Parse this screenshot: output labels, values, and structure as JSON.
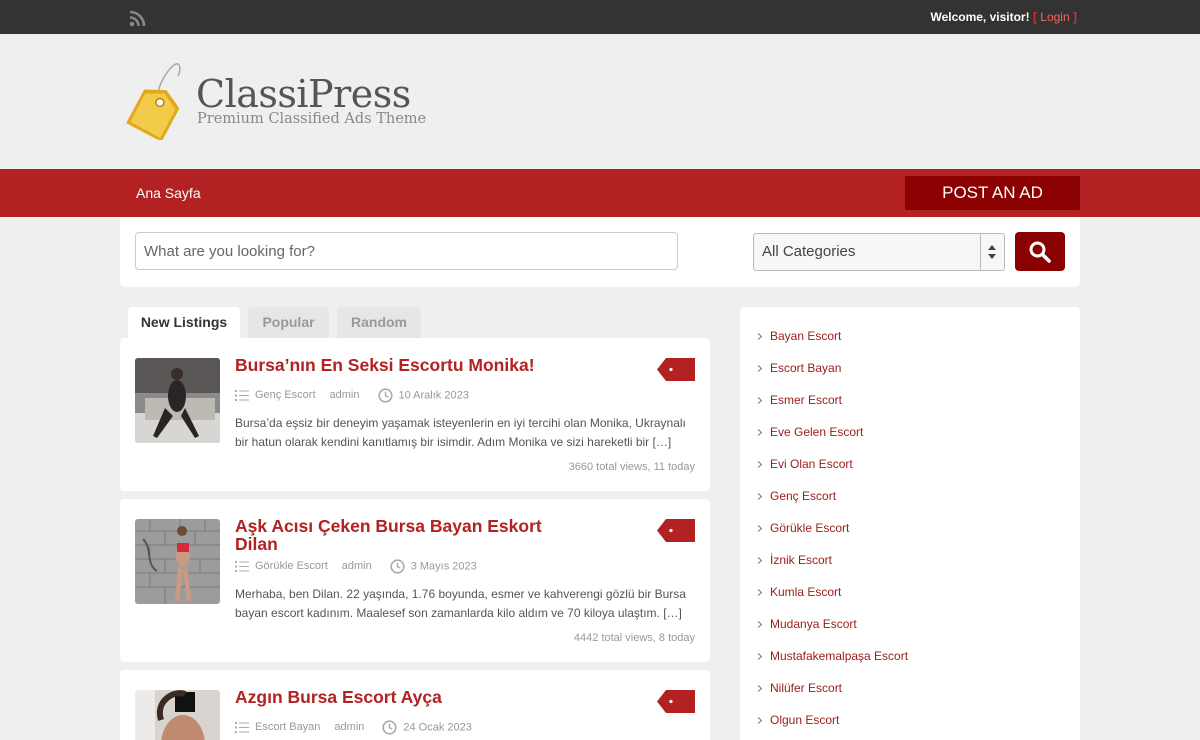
{
  "topbar": {
    "welcome_prefix": "Welcome, ",
    "welcome_user": "visitor!",
    "bracket_open": " [ ",
    "login": "Login",
    "bracket_close": " ]"
  },
  "header": {
    "logo_title": "ClassiPress",
    "logo_subtitle": "Premium Classified Ads Theme"
  },
  "nav": {
    "home": "Ana Sayfa",
    "post_ad": "POST AN AD"
  },
  "search": {
    "placeholder": "What are you looking for?",
    "category_selected": "All Categories"
  },
  "tabs": [
    {
      "label": "New Listings",
      "active": true
    },
    {
      "label": "Popular",
      "active": false
    },
    {
      "label": "Random",
      "active": false
    }
  ],
  "listings": [
    {
      "title": "Bursa’nın En Seksi Escortu Monika!",
      "category": "Genç Escort",
      "author": "admin",
      "date": "10 Aralık 2023",
      "description": "Bursa’da eşsiz bir deneyim yaşamak isteyenlerin en iyi tercihi olan Monika, Ukraynalı bir hatun olarak kendini kanıtlamış bir isimdir. Adım Monika ve sizi hareketli bir […]",
      "views": "3660 total views, 11 today"
    },
    {
      "title": "Aşk Acısı Çeken Bursa Bayan Eskort Dilan",
      "category": "Görükle Escort",
      "author": "admin",
      "date": "3 Mayıs 2023",
      "description": "Merhaba, ben Dilan. 22 yaşında, 1.76 boyunda, esmer ve kahverengi gözlü bir Bursa bayan escort kadınım. Maalesef son zamanlarda kilo aldım ve 70 kiloya ulaştım. […]",
      "views": "4442 total views, 8 today"
    },
    {
      "title": "Azgın Bursa Escort Ayça",
      "category": "Escort Bayan",
      "author": "admin",
      "date": "24 Ocak 2023"
    }
  ],
  "sidebar": {
    "categories": [
      "Bayan Escort",
      "Escort Bayan",
      "Esmer Escort",
      "Eve Gelen Escort",
      "Evi Olan Escort",
      "Genç Escort",
      "Görükle Escort",
      "İznik Escort",
      "Kumla Escort",
      "Mudanya Escort",
      "Mustafakemalpaşa Escort",
      "Nilüfer Escort",
      "Olgun Escort"
    ]
  },
  "colors": {
    "topbar": "#333333",
    "nav": "#b22222",
    "accent_dark": "#8b0000",
    "title_red": "#b22222"
  }
}
